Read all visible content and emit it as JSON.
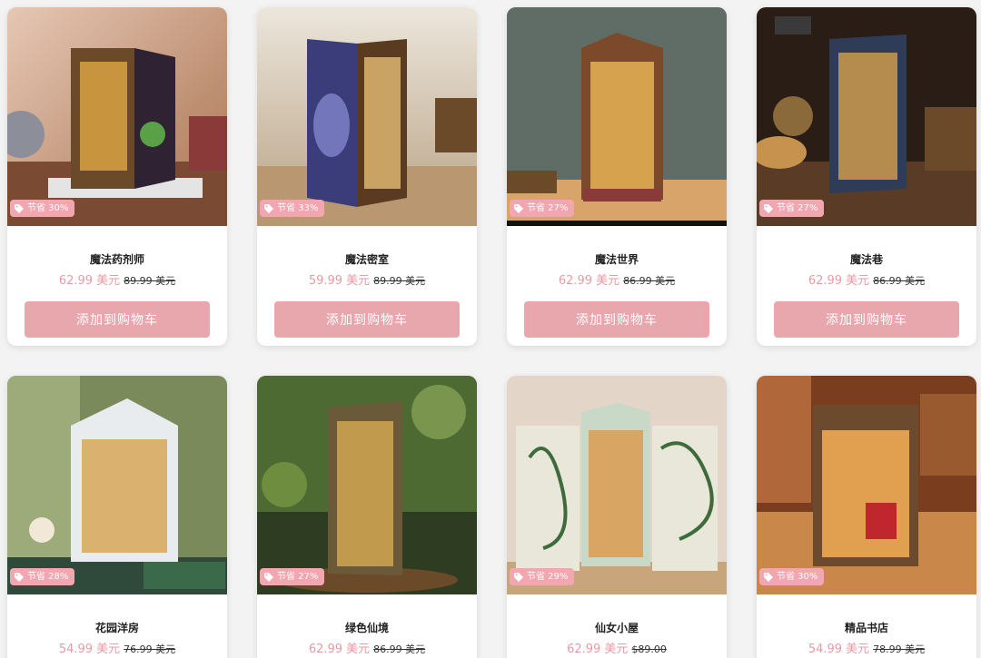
{
  "colors": {
    "accent": "#e8a6ad",
    "price": "#e99aa4",
    "badge": "#f2a7b0"
  },
  "products": [
    {
      "title": "魔法药剂师",
      "badge": "节省 30%",
      "price": "62.99 美元",
      "old_price": "89.99 美元",
      "button": "添加到购物车"
    },
    {
      "title": "魔法密室",
      "badge": "节省 33%",
      "price": "59.99 美元",
      "old_price": "89.99 美元",
      "button": "添加到购物车"
    },
    {
      "title": "魔法世界",
      "badge": "节省 27%",
      "price": "62.99 美元",
      "old_price": "86.99 美元",
      "button": "添加到购物车"
    },
    {
      "title": "魔法巷",
      "badge": "节省 27%",
      "price": "62.99 美元",
      "old_price": "86.99 美元",
      "button": "添加到购物车"
    },
    {
      "title": "花园洋房",
      "badge": "节省 28%",
      "price": "54.99 美元",
      "old_price": "76.99 美元"
    },
    {
      "title": "绿色仙境",
      "badge": "节省 27%",
      "price": "62.99 美元",
      "old_price": "86.99 美元"
    },
    {
      "title": "仙女小屋",
      "badge": "节省 29%",
      "price": "62.99 美元",
      "old_price": "$89.00"
    },
    {
      "title": "精品书店",
      "badge": "节省 30%",
      "price": "54.99 美元",
      "old_price": "78.99 美元"
    }
  ]
}
